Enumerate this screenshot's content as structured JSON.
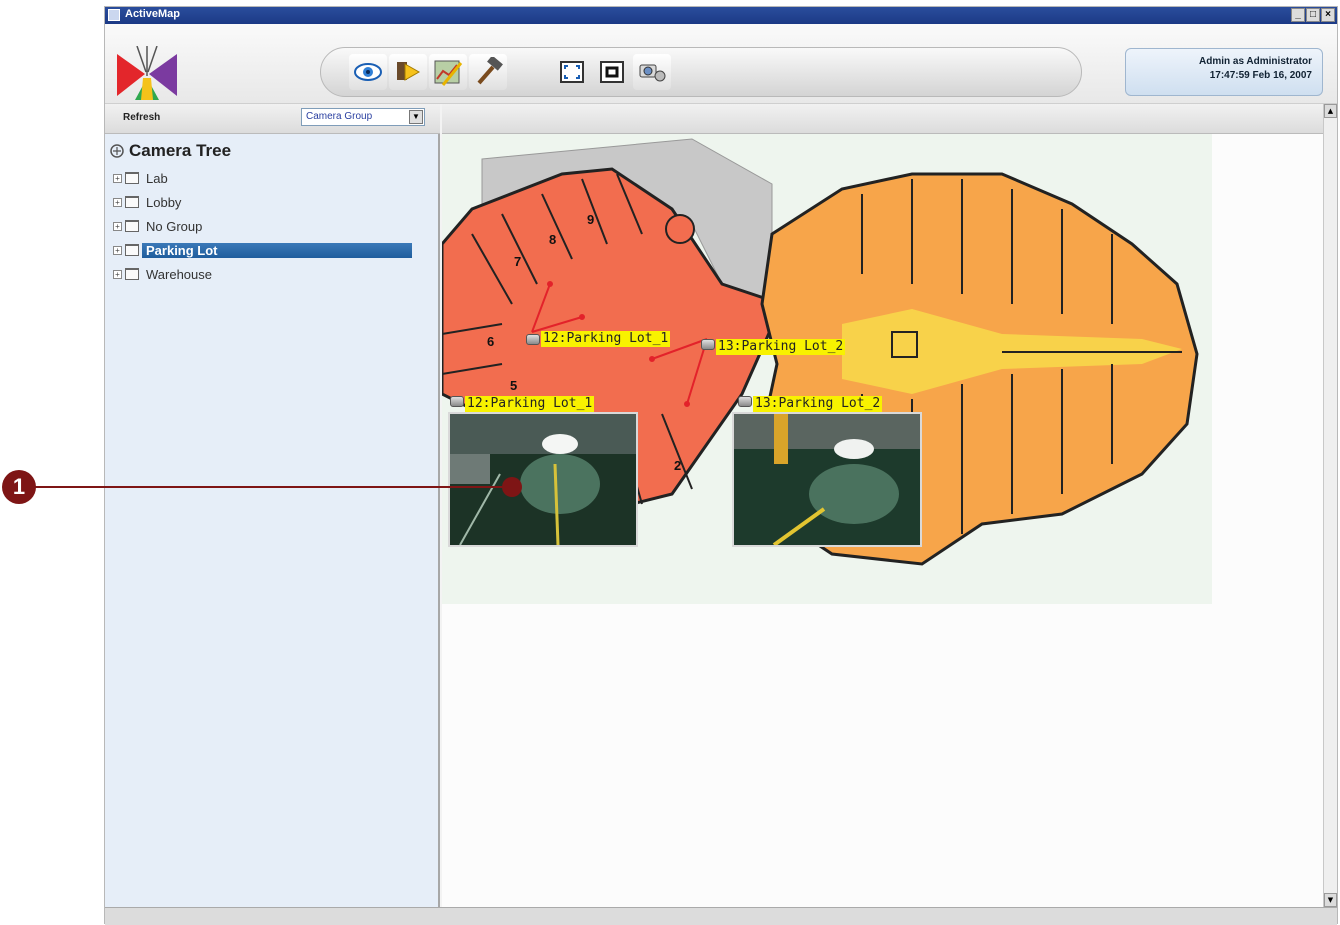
{
  "window": {
    "title": "ActiveMap",
    "controls": [
      "_",
      "□",
      "×"
    ]
  },
  "header": {
    "tools": [
      {
        "name": "eye-icon"
      },
      {
        "name": "camera-arrow-icon"
      },
      {
        "name": "map-edit-icon"
      },
      {
        "name": "hammer-icon"
      },
      {
        "name": "fullscreen-icon"
      },
      {
        "name": "rotate-icon"
      },
      {
        "name": "camera-settings-icon"
      }
    ],
    "user": {
      "line1": "Admin as Administrator",
      "line2": "17:47:59 Feb 16, 2007"
    }
  },
  "left_toolbar": {
    "refresh_label": "Refresh",
    "group_select_value": "Camera Group"
  },
  "tree": {
    "title": "Camera Tree",
    "items": [
      {
        "label": "Lab",
        "selected": false
      },
      {
        "label": "Lobby",
        "selected": false
      },
      {
        "label": "No Group",
        "selected": false
      },
      {
        "label": "Parking Lot",
        "selected": true
      },
      {
        "label": "Warehouse",
        "selected": false
      }
    ]
  },
  "map": {
    "camera_labels": [
      "12:Parking Lot_1",
      "13:Parking Lot_2",
      "12:Parking Lot_1",
      "13:Parking Lot_2"
    ],
    "space_numbers": [
      "7",
      "8",
      "9",
      "6",
      "5",
      "2"
    ]
  },
  "callout": {
    "number": "1"
  },
  "colors": {
    "title_bar": "#1c3a86",
    "parking_zone": "#f26d4f",
    "building": "#f7a54a",
    "lobby": "#f8d24a",
    "label_bg": "#f8f200",
    "callout": "#7e1515",
    "selected_item": "#2b6aa9"
  }
}
